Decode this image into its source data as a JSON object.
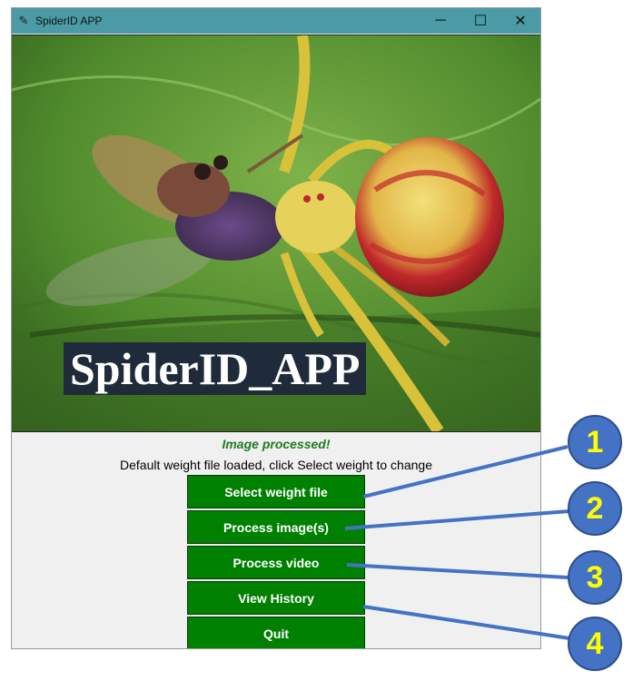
{
  "window": {
    "title": "SpiderID APP",
    "app_icon": "feather-icon"
  },
  "titlebar_controls": {
    "minimize": "─",
    "maximize": "☐",
    "close": "✕"
  },
  "banner_text": "SpiderID_APP",
  "status": {
    "processed": "Image processed!",
    "info": "Default weight file loaded, click Select weight to change"
  },
  "buttons": {
    "select_weight": "Select weight file",
    "process_images": "Process image(s)",
    "process_video": "Process video",
    "view_history": "View History",
    "quit": "Quit"
  },
  "annotations": [
    "1",
    "2",
    "3",
    "4"
  ],
  "colors": {
    "button_green": "#008000",
    "titlebar": "#4a9ba6",
    "badge_blue": "#4472c4",
    "badge_text": "#ffff00",
    "status_green": "#1f7a1f"
  }
}
